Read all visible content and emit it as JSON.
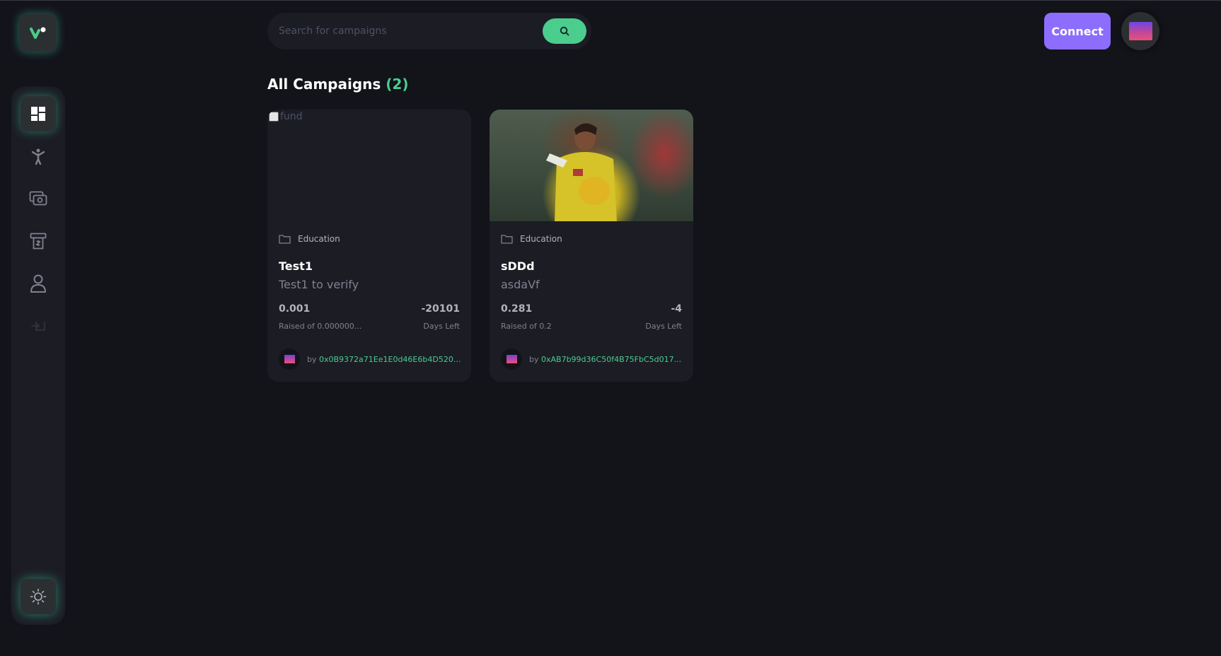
{
  "header": {
    "search_placeholder": "Search for campaigns",
    "connect_label": "Connect"
  },
  "sidebar": {
    "items": [
      {
        "name": "dashboard",
        "icon": "dashboard-icon",
        "active": true
      },
      {
        "name": "create-campaign",
        "icon": "create-campaign-icon",
        "active": false
      },
      {
        "name": "payment",
        "icon": "payment-icon",
        "active": false
      },
      {
        "name": "withdraw",
        "icon": "withdraw-icon",
        "active": false
      },
      {
        "name": "profile",
        "icon": "profile-icon",
        "active": false
      },
      {
        "name": "logout",
        "icon": "logout-icon",
        "active": false,
        "disabled": true
      }
    ],
    "theme_icon": "sun-icon"
  },
  "main": {
    "title": "All Campaigns",
    "count": "(2)"
  },
  "campaigns": [
    {
      "image_alt": "fund",
      "category": "Education",
      "title": "Test1",
      "description": "Test1 to verify",
      "raised": "0.001",
      "raised_label": "Raised of 0.000000...",
      "days": "-20101",
      "days_label": "Days Left",
      "by": "by",
      "owner": "0x0B9372a71Ee1E0d46E6b4D520..."
    },
    {
      "image_alt": "",
      "category": "Education",
      "title": "sDDd",
      "description": "asdaVf",
      "raised": "0.281",
      "raised_label": "Raised of 0.2",
      "days": "-4",
      "days_label": "Days Left",
      "by": "by",
      "owner": "0xAB7b99d36C50f4B75FbC5d017..."
    }
  ],
  "colors": {
    "background": "#13131a",
    "panel": "#1c1c24",
    "accent_green": "#4acd8d",
    "accent_purple": "#8c6dfd",
    "muted": "#808191"
  }
}
